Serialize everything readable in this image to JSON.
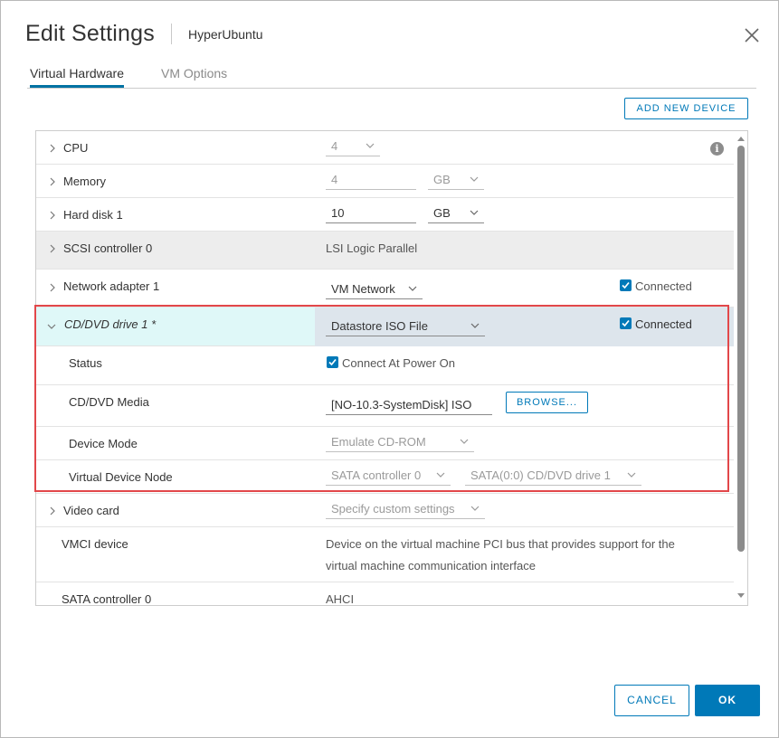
{
  "dialog": {
    "title": "Edit Settings",
    "vm_name": "HyperUbuntu"
  },
  "tabs": [
    {
      "label": "Virtual Hardware",
      "active": true
    },
    {
      "label": "VM Options",
      "active": false
    }
  ],
  "add_device_label": "ADD NEW DEVICE",
  "hardware": {
    "cpu": {
      "label": "CPU",
      "value": "4"
    },
    "memory": {
      "label": "Memory",
      "value": "4",
      "unit": "GB"
    },
    "hard_disk": {
      "label": "Hard disk 1",
      "value": "10",
      "unit": "GB"
    },
    "scsi": {
      "label": "SCSI controller 0",
      "value": "LSI Logic Parallel"
    },
    "network": {
      "label": "Network adapter 1",
      "value": "VM Network",
      "connected_label": "Connected",
      "connected": true
    },
    "cddvd": {
      "label": "CD/DVD drive 1 *",
      "value": "Datastore ISO File",
      "connected_label": "Connected",
      "connected": true,
      "status_label": "Status",
      "status_value": "Connect At Power On",
      "media_label": "CD/DVD Media",
      "media_value": "[NO-10.3-SystemDisk] ISO",
      "browse_label": "BROWSE...",
      "mode_label": "Device Mode",
      "mode_value": "Emulate CD-ROM",
      "node_label": "Virtual Device Node",
      "node_controller": "SATA controller 0",
      "node_device": "SATA(0:0) CD/DVD drive 1"
    },
    "video": {
      "label": "Video card",
      "value": "Specify custom settings"
    },
    "vmci": {
      "label": "VMCI device",
      "line1": "Device on the virtual machine PCI bus that provides support for the",
      "line2": "virtual machine communication interface"
    },
    "sata": {
      "label": "SATA controller 0",
      "value": "AHCI"
    }
  },
  "footer": {
    "cancel_label": "CANCEL",
    "ok_label": "OK"
  },
  "colors": {
    "accent": "#0079b8",
    "selected_row": "#dff8f8",
    "highlight_border": "#e2474a"
  },
  "icons": {
    "close": "close-icon",
    "info": "info-icon",
    "chevron": "chevron-right-icon"
  }
}
